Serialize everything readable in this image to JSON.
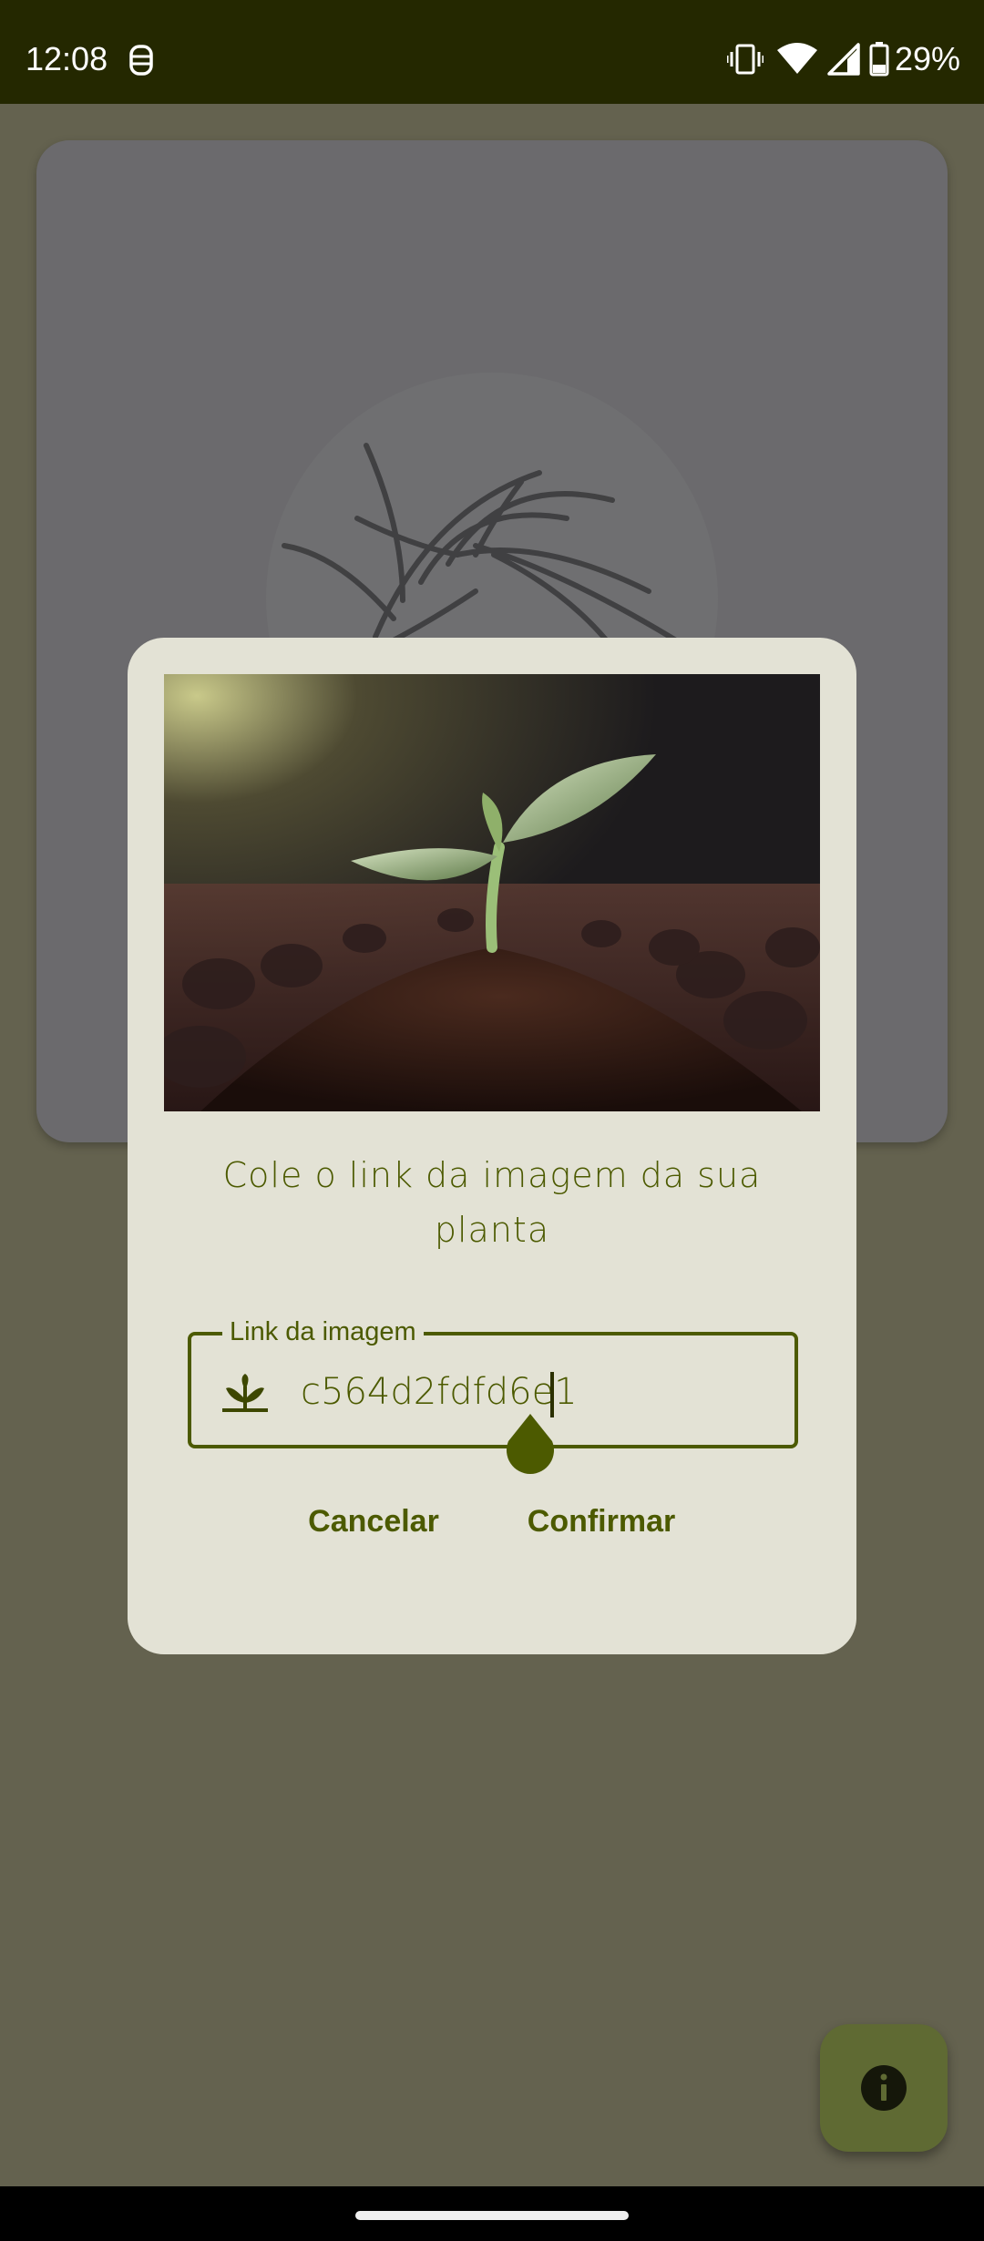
{
  "status_bar": {
    "time": "12:08",
    "battery": "29%",
    "icons": [
      "media-icon",
      "vibrate-icon",
      "wifi-icon",
      "signal-icon",
      "battery-icon"
    ]
  },
  "dialog": {
    "title": "Cole o link da imagem da sua planta",
    "image_alt": "seedling-image",
    "field": {
      "label": "Link da imagem",
      "value": "c564d2fdfd6e1",
      "icon": "plant-sprout-icon"
    },
    "cancel_label": "Cancelar",
    "confirm_label": "Confirmar"
  },
  "fab": {
    "icon": "info-icon"
  },
  "colors": {
    "accent": "#4c5a00",
    "dialog_bg": "#e3e2d5",
    "scrim": "#64624f",
    "status_bar": "#242800",
    "fab": "#5f6a33"
  }
}
